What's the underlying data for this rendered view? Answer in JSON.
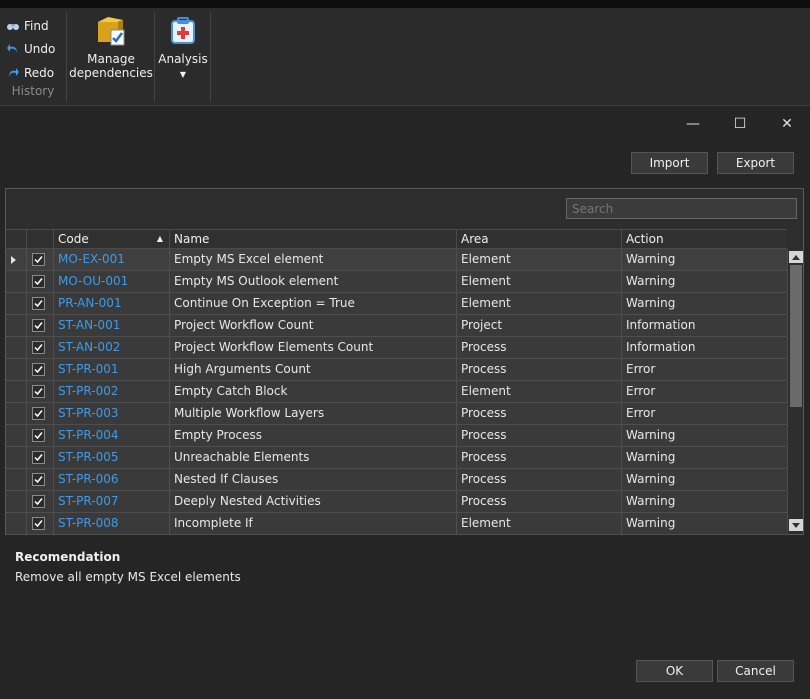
{
  "ribbon": {
    "history": {
      "find_label": "Find",
      "undo_label": "Undo",
      "redo_label": "Redo",
      "group_label": "History"
    },
    "manage_dependencies_label_line1": "Manage",
    "manage_dependencies_label_line2": "dependencies",
    "analysis_label": "Analysis"
  },
  "window": {
    "minimize_glyph": "—",
    "maximize_glyph": "☐",
    "close_glyph": "✕"
  },
  "toolbar": {
    "import_label": "Import",
    "export_label": "Export"
  },
  "search": {
    "placeholder": "Search"
  },
  "grid": {
    "columns": {
      "code": "Code",
      "name": "Name",
      "area": "Area",
      "action": "Action"
    },
    "sort_column": "Code",
    "sort_direction": "ascending",
    "rows": [
      {
        "checked": true,
        "code": "MO-EX-001",
        "name": "Empty MS Excel element",
        "area": "Element",
        "action": "Warning"
      },
      {
        "checked": true,
        "code": "MO-OU-001",
        "name": "Empty MS Outlook element",
        "area": "Element",
        "action": "Warning"
      },
      {
        "checked": true,
        "code": "PR-AN-001",
        "name": "Continue On Exception = True",
        "area": "Element",
        "action": "Warning"
      },
      {
        "checked": true,
        "code": "ST-AN-001",
        "name": "Project Workflow Count",
        "area": "Project",
        "action": "Information"
      },
      {
        "checked": true,
        "code": "ST-AN-002",
        "name": "Project Workflow Elements Count",
        "area": "Process",
        "action": "Information"
      },
      {
        "checked": true,
        "code": "ST-PR-001",
        "name": "High Arguments Count",
        "area": "Process",
        "action": "Error"
      },
      {
        "checked": true,
        "code": "ST-PR-002",
        "name": "Empty Catch Block",
        "area": "Element",
        "action": "Error"
      },
      {
        "checked": true,
        "code": "ST-PR-003",
        "name": "Multiple Workflow Layers",
        "area": "Process",
        "action": "Error"
      },
      {
        "checked": true,
        "code": "ST-PR-004",
        "name": "Empty Process",
        "area": "Process",
        "action": "Warning"
      },
      {
        "checked": true,
        "code": "ST-PR-005",
        "name": "Unreachable Elements",
        "area": "Process",
        "action": "Warning"
      },
      {
        "checked": true,
        "code": "ST-PR-006",
        "name": "Nested If Clauses",
        "area": "Process",
        "action": "Warning"
      },
      {
        "checked": true,
        "code": "ST-PR-007",
        "name": "Deeply Nested Activities",
        "area": "Process",
        "action": "Warning"
      },
      {
        "checked": true,
        "code": "ST-PR-008",
        "name": "Incomplete If",
        "area": "Element",
        "action": "Warning"
      }
    ]
  },
  "recommendation": {
    "title": "Recomendation",
    "text": "Remove all empty MS Excel elements"
  },
  "footer": {
    "ok_label": "OK",
    "cancel_label": "Cancel"
  },
  "colors": {
    "background": "#252526",
    "code_link": "#3d9be9"
  }
}
